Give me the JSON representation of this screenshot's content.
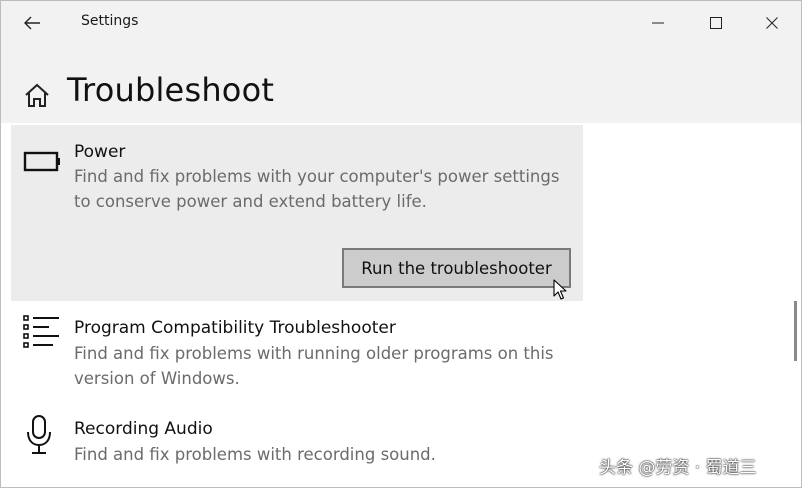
{
  "titlebar": {
    "app_title": "Settings",
    "back_icon": "back-arrow-icon",
    "minimize_icon": "minimize-icon",
    "maximize_icon": "maximize-icon",
    "close_icon": "close-icon"
  },
  "header": {
    "home_icon": "home-icon",
    "title": "Troubleshoot"
  },
  "items": [
    {
      "icon": "battery-icon",
      "title": "Power",
      "description": "Find and fix problems with your computer's power settings to conserve power and extend battery life.",
      "selected": true,
      "button_label": "Run the troubleshooter"
    },
    {
      "icon": "list-icon",
      "title": "Program Compatibility Troubleshooter",
      "description": "Find and fix problems with running older programs on this version of Windows.",
      "selected": false
    },
    {
      "icon": "microphone-icon",
      "title": "Recording Audio",
      "description": "Find and fix problems with recording sound.",
      "selected": false
    }
  ],
  "watermark": "头条 @劳资 · 蜀道三",
  "colors": {
    "titlebar_bg": "#f2f2f2",
    "selected_bg": "#ececec",
    "button_bg": "#cccccc",
    "description_text": "#6b6b6b"
  }
}
